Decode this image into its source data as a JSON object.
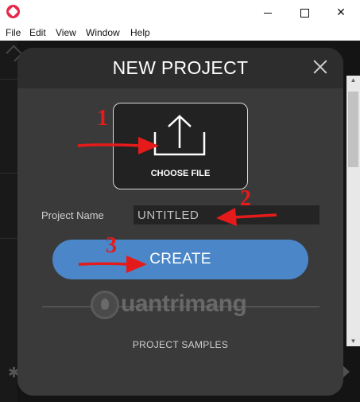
{
  "menu": {
    "items": [
      {
        "label": "File"
      },
      {
        "label": "Edit"
      },
      {
        "label": "View"
      },
      {
        "label": "Window"
      },
      {
        "label": "Help"
      }
    ]
  },
  "window_controls": {
    "minimize_icon": "minimize-icon",
    "maximize_icon": "maximize-icon",
    "close_icon": "close-icon"
  },
  "modal": {
    "title": "NEW PROJECT",
    "choose_file_label": "CHOOSE FILE",
    "project_name_label": "Project Name",
    "project_name_value": "UNTITLED",
    "create_label": "CREATE",
    "samples_label": "PROJECT SAMPLES"
  },
  "annotations": {
    "step1": "1",
    "step2": "2",
    "step3": "3",
    "color": "#e51b1b"
  },
  "watermark": {
    "text": "uantrimang"
  },
  "colors": {
    "modal_bg": "#3a3a3a",
    "create_button": "#4a86c8",
    "app_icon": "#e8284a"
  }
}
